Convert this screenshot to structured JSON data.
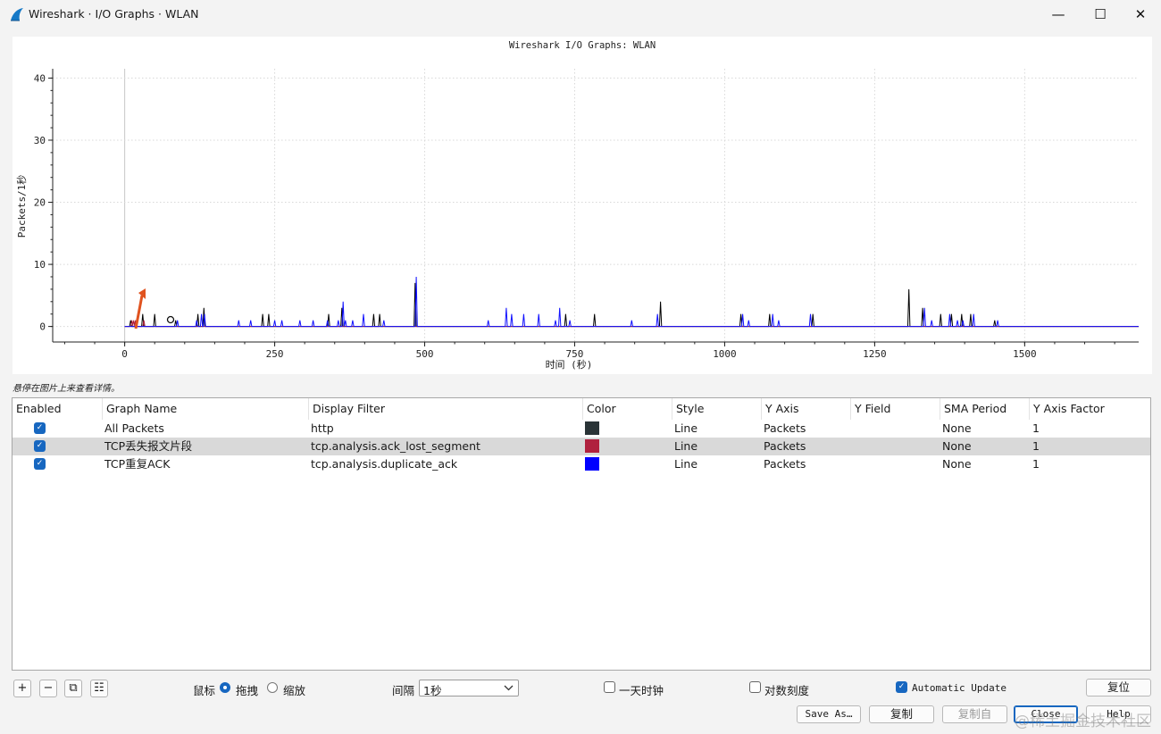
{
  "window": {
    "title": "Wireshark · I/O Graphs · WLAN",
    "controls": {
      "minimize": "—",
      "maximize": "☐",
      "close": "✕"
    }
  },
  "plot_hint": "悬停在图片上来查看详情。",
  "chart_data": {
    "type": "line",
    "title": "Wireshark I/O Graphs: WLAN",
    "xlabel": "时间 (秒)",
    "ylabel": "Packets/1秒",
    "xlim": [
      -120,
      1690
    ],
    "ylim": [
      -2.5,
      41.5
    ],
    "x_ticks": [
      0,
      250,
      500,
      750,
      1000,
      1250,
      1500
    ],
    "y_ticks": [
      0,
      10,
      20,
      30,
      40
    ],
    "grid": true,
    "series": [
      {
        "name": "All Packets",
        "color": "#000000",
        "points": [
          [
            10,
            1
          ],
          [
            30,
            2
          ],
          [
            50,
            2
          ],
          [
            85,
            1
          ],
          [
            122,
            2
          ],
          [
            132,
            3
          ],
          [
            230,
            2
          ],
          [
            240,
            2
          ],
          [
            340,
            2
          ],
          [
            362,
            3
          ],
          [
            415,
            2
          ],
          [
            425,
            2
          ],
          [
            484,
            7
          ],
          [
            735,
            2
          ],
          [
            783,
            2
          ],
          [
            893,
            4
          ],
          [
            1027,
            2
          ],
          [
            1075,
            2
          ],
          [
            1147,
            2
          ],
          [
            1307,
            6
          ],
          [
            1330,
            3
          ],
          [
            1360,
            2
          ],
          [
            1378,
            2
          ],
          [
            1395,
            2
          ],
          [
            1410,
            2
          ],
          [
            1450,
            1
          ]
        ]
      },
      {
        "name": "TCP丢失报文片段",
        "color": "#b0203c",
        "points": [
          [
            12,
            1
          ],
          [
            15,
            1
          ],
          [
            18,
            1
          ],
          [
            32,
            1
          ]
        ]
      },
      {
        "name": "TCP重复ACK",
        "color": "#1010ff",
        "points": [
          [
            88,
            1
          ],
          [
            120,
            1
          ],
          [
            128,
            2
          ],
          [
            133,
            2
          ],
          [
            190,
            1
          ],
          [
            210,
            1
          ],
          [
            250,
            1
          ],
          [
            262,
            1
          ],
          [
            292,
            1
          ],
          [
            314,
            1
          ],
          [
            338,
            1
          ],
          [
            356,
            1
          ],
          [
            364,
            4
          ],
          [
            368,
            1
          ],
          [
            380,
            1
          ],
          [
            398,
            2
          ],
          [
            432,
            1
          ],
          [
            486,
            8
          ],
          [
            606,
            1
          ],
          [
            636,
            3
          ],
          [
            645,
            2
          ],
          [
            665,
            2
          ],
          [
            690,
            2
          ],
          [
            718,
            1
          ],
          [
            725,
            3
          ],
          [
            742,
            1
          ],
          [
            845,
            1
          ],
          [
            888,
            2
          ],
          [
            1030,
            2
          ],
          [
            1040,
            1
          ],
          [
            1080,
            2
          ],
          [
            1090,
            1
          ],
          [
            1143,
            2
          ],
          [
            1333,
            3
          ],
          [
            1345,
            1
          ],
          [
            1375,
            2
          ],
          [
            1388,
            1
          ],
          [
            1397,
            1
          ],
          [
            1415,
            2
          ],
          [
            1455,
            1
          ]
        ]
      }
    ],
    "annotations": [
      "red-arrow",
      "circle-marker"
    ]
  },
  "table": {
    "headers": [
      "Enabled",
      "Graph Name",
      "Display Filter",
      "Color",
      "Style",
      "Y Axis",
      "Y Field",
      "SMA Period",
      "Y Axis Factor"
    ],
    "rows": [
      {
        "enabled": "✓",
        "name": "All Packets",
        "filter": "http",
        "color": "#2a3437",
        "style": "Line",
        "yaxis": "Packets",
        "yfield": "",
        "sma": "None",
        "factor": "1",
        "selected": false
      },
      {
        "enabled": "✓",
        "name": "TCP丢失报文片段",
        "filter": "tcp.analysis.ack_lost_segment",
        "color": "#b0213e",
        "style": "Line",
        "yaxis": "Packets",
        "yfield": "",
        "sma": "None",
        "factor": "1",
        "selected": true
      },
      {
        "enabled": "✓",
        "name": "TCP重复ACK",
        "filter": "tcp.analysis.duplicate_ack",
        "color": "#0000ff",
        "style": "Line",
        "yaxis": "Packets",
        "yfield": "",
        "sma": "None",
        "factor": "1",
        "selected": false
      }
    ]
  },
  "toolbar": {
    "add": "+",
    "remove": "−",
    "copy": "⧉",
    "clear": "☷",
    "mouse_label": "鼠标",
    "drag_label": "拖拽",
    "zoom_label": "缩放",
    "interval_label": "间隔",
    "interval_value": "1秒",
    "time_of_day_label": "一天时钟",
    "log_scale_label": "对数刻度",
    "auto_update_label": "Automatic Update",
    "reset_label": "复位"
  },
  "buttons": {
    "save_as": "Save As…",
    "copy": "复制",
    "copy_from": "复制自",
    "close": "Close",
    "help": "Help"
  },
  "watermark": "@稀土掘金技术社区"
}
